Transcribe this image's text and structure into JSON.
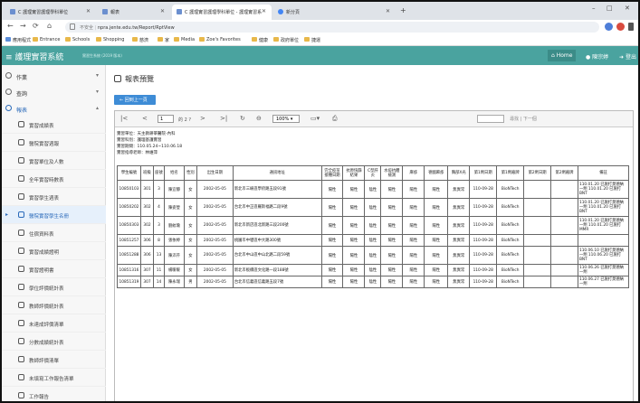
{
  "browser": {
    "tabs": [
      {
        "label": "C 護理實習護理學科單位"
      },
      {
        "label": "報表"
      },
      {
        "label": "C 護理實習護理學科單位 - 護理實習系"
      },
      {
        "label": "新分頁"
      }
    ],
    "new_tab": "+",
    "url": "npra.jente.edu.tw/Report/RptView",
    "url_prefix": "不安全",
    "bookmarks": [
      "應用程式",
      "Entrance",
      "Schools",
      "Shopping",
      "慈濟",
      "家",
      "Media",
      "Zoe's Favorites",
      "健康",
      "政府單位",
      "捷運"
    ]
  },
  "app": {
    "brand": "護理實習系統",
    "brand_sub": "實習生系統 (2019 版本)",
    "home_label": "Home",
    "user_label": "陳宗婷",
    "logout_label": "登出"
  },
  "sidebar": {
    "menus": [
      {
        "label": "作業"
      },
      {
        "label": "查詢"
      },
      {
        "label": "報表"
      }
    ],
    "items": [
      {
        "label": "實習成績表"
      },
      {
        "label": "醫院實習週報"
      },
      {
        "label": "實習單位及人數"
      },
      {
        "label": "全年實習時數表"
      },
      {
        "label": "實習學生週表"
      },
      {
        "label": "醫院實習學生名冊"
      },
      {
        "label": "住宿資料表"
      },
      {
        "label": "實習成績證明"
      },
      {
        "label": "實習證明書"
      },
      {
        "label": "學位評價統計表"
      },
      {
        "label": "教師評價統計表"
      },
      {
        "label": "未達成評價清單"
      },
      {
        "label": "分數成績統計表"
      },
      {
        "label": "教師評價清單"
      },
      {
        "label": "未填寫工作報告清單"
      },
      {
        "label": "工作報告"
      }
    ]
  },
  "main": {
    "title": "報表預覽",
    "back_label": "回到上一頁"
  },
  "viewer": {
    "page": "1",
    "page_of": "的 2 ?",
    "zoom": "100%",
    "find_text": "尋找 | 下一個"
  },
  "report": {
    "info": [
      "實習單位：天主教耕莘醫院-內科",
      "實習科別：護理基護實習",
      "實習期間：110.05.24~110.06.18",
      "實習指導老師：林維萍"
    ],
    "headers": [
      "學生編號",
      "班級",
      "座號",
      "姓名",
      "性別",
      "出生日期",
      "通訊地址",
      "完全疫苗接種日期",
      "抗原快篩結果",
      "C型肝炎",
      "水痘抗體檢測",
      "麻疹",
      "德國麻疹",
      "胸部X光",
      "第1劑日期",
      "第1劑廠牌",
      "第2劑日期",
      "第2劑廠牌",
      "備註"
    ],
    "rows": [
      [
        "10850103",
        "301",
        "3",
        "陳宜靜",
        "女",
        "2002-05-05",
        "新北市三峽區學府路五段91號",
        "陽性",
        "陽性",
        "陰性",
        "陽性",
        "陽性",
        "陽性",
        "無異常",
        "110-09-28",
        "BioNTech",
        "",
        "",
        "110.01.20 已施打莫德納一劑 110.01.20 已施打BNT"
      ],
      [
        "10850202",
        "302",
        "4",
        "陳姿瑩",
        "女",
        "2002-05-05",
        "台北市中正區羅斯福路二段9號",
        "陽性",
        "陽性",
        "陰性",
        "陽性",
        "陽性",
        "陽性",
        "無異常",
        "110-09-28",
        "BioNTech",
        "",
        "",
        "110.01.20 已施打莫德納一劑 110.01.20 已施打BNT"
      ],
      [
        "10850303",
        "302",
        "3",
        "劉紋瑜",
        "女",
        "2002-05-05",
        "新北市新店區北新路三段200號",
        "陽性",
        "陽性",
        "陰性",
        "陽性",
        "陽性",
        "陽性",
        "無異常",
        "110-09-28",
        "BioNTech",
        "",
        "",
        "110.01.20 已施打莫德納一劑 110.01.20 已施打 MMR"
      ],
      [
        "10851257",
        "306",
        "8",
        "張依婷",
        "女",
        "2002-05-05",
        "桃園市中壢區中大路300號",
        "陽性",
        "陽性",
        "陰性",
        "陽性",
        "陽性",
        "陽性",
        "無異常",
        "110-09-28",
        "BioNTech",
        "",
        "",
        ""
      ],
      [
        "10851288",
        "306",
        "13",
        "陳沛芹",
        "女",
        "2002-05-05",
        "台北市中山區中山北路二段59號",
        "陽性",
        "陽性",
        "陰性",
        "陽性",
        "陽性",
        "陽性",
        "無異常",
        "110-09-28",
        "BioNTech",
        "",
        "",
        "110.06.10 已施打莫德納一劑 110.06.20 已施打BNT"
      ],
      [
        "10851316",
        "307",
        "11",
        "楊暖暖",
        "女",
        "2002-05-05",
        "新北市板橋區文化路一段188號",
        "陽性",
        "陽性",
        "陰性",
        "陽性",
        "陽性",
        "陽性",
        "無異常",
        "110-09-28",
        "BioNTech",
        "",
        "",
        "110.06.26 已施打莫德納一劑"
      ],
      [
        "10851319",
        "307",
        "14",
        "陳永瑞",
        "男",
        "2002-05-05",
        "台北市信義區信義路五段7號",
        "陽性",
        "陽性",
        "陰性",
        "陽性",
        "陽性",
        "陽性",
        "無異常",
        "110-09-28",
        "BioNTech",
        "",
        "",
        "110.06.27 已施打莫德納一劑"
      ]
    ]
  }
}
